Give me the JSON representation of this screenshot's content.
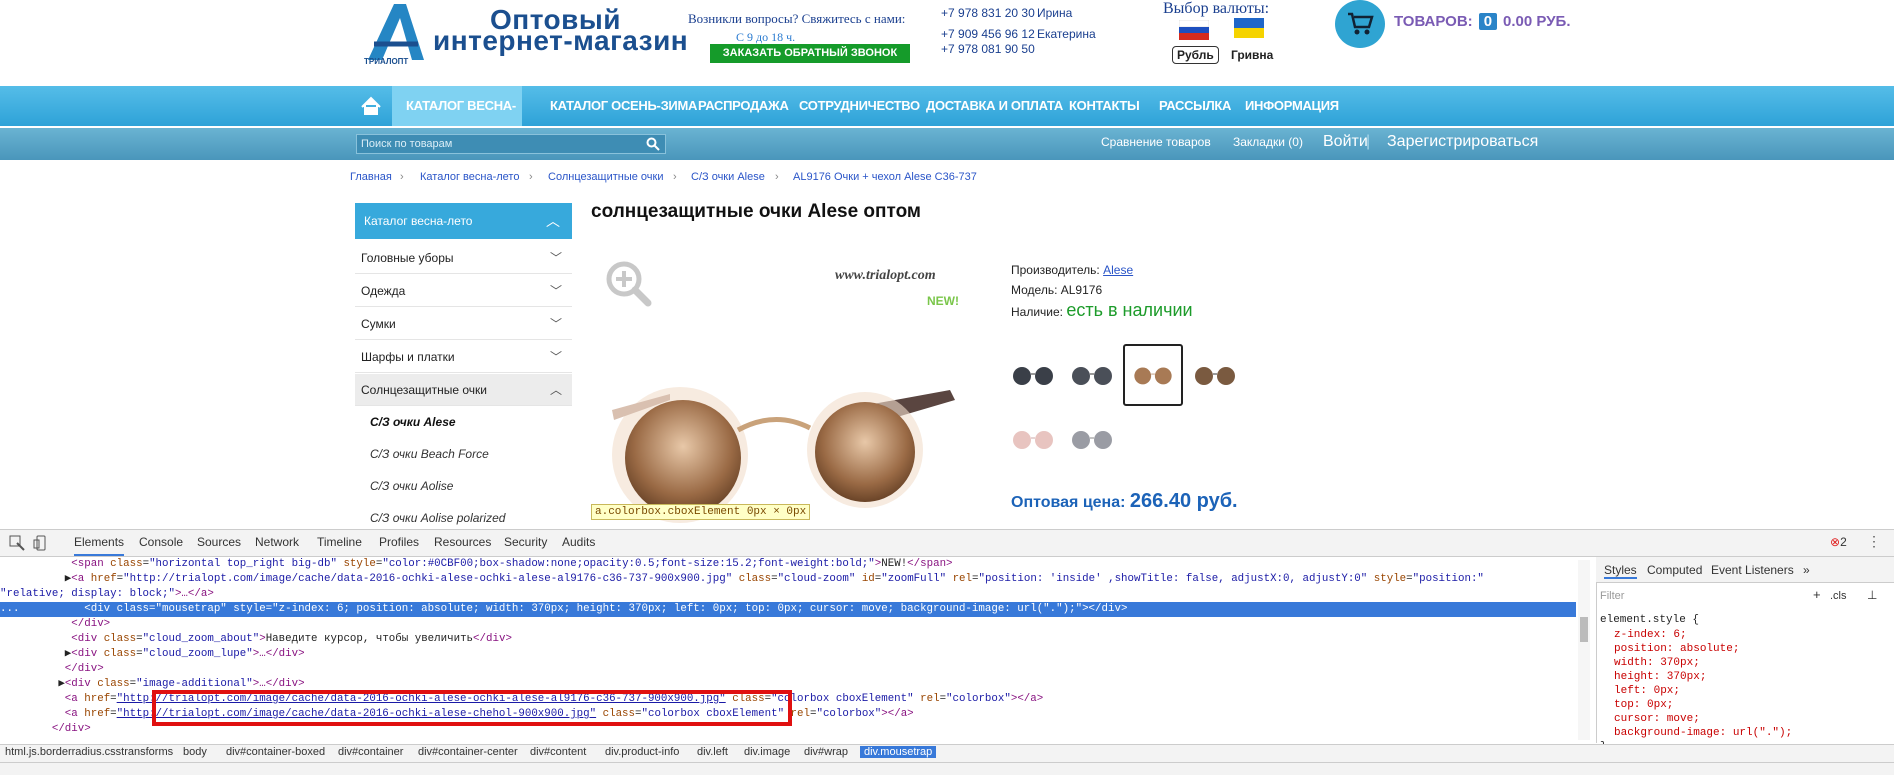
{
  "header": {
    "logo_line1": "Оптовый",
    "logo_line2": "интернет-магазин",
    "logo_small": "ТРИАЛОПТ",
    "questions": "Возникли вопросы? Свяжитесь с нами:",
    "hours": "С 9 до 18 ч.",
    "callback_label": "ЗАКАЗАТЬ ОБРАТНЫЙ ЗВОНОК",
    "phones": [
      {
        "number": "+7 978 831 20 30",
        "name": "Ирина"
      },
      {
        "number": "+7 909 456 96 12",
        "name": "Екатерина"
      },
      {
        "number": "+7 978 081 90 50",
        "name": ""
      }
    ],
    "currency_title": "Выбор валюты:",
    "currencies": [
      {
        "label": "Рубль",
        "flag": "russia-flag",
        "selected": true
      },
      {
        "label": "Гривна",
        "flag": "ukraine-flag",
        "selected": false
      }
    ],
    "cart_label": "ТОВАРОВ:",
    "cart_count": "0",
    "cart_total": "0.00 РУБ."
  },
  "nav": {
    "items": [
      {
        "label": "КАТАЛОГ ВЕСНА-ЛЕТО",
        "active": true
      },
      {
        "label": "КАТАЛОГ ОСЕНЬ-ЗИМА",
        "active": false
      },
      {
        "label": "РАСПРОДАЖА",
        "active": false
      },
      {
        "label": "СОТРУДНИЧЕСТВО",
        "active": false
      },
      {
        "label": "ДОСТАВКА И ОПЛАТА",
        "active": false
      },
      {
        "label": "КОНТАКТЫ",
        "active": false
      },
      {
        "label": "РАССЫЛКА",
        "active": false
      },
      {
        "label": "ИНФОРМАЦИЯ",
        "active": false
      }
    ]
  },
  "subbar": {
    "search_placeholder": "Поиск по товарам",
    "compare": "Сравнение товаров",
    "bookmarks": "Закладки (0)",
    "login": "Войти",
    "register": "Зарегистрироваться"
  },
  "breadcrumbs": [
    "Главная",
    "Каталог весна-лето",
    "Солнцезащитные очки",
    "С/З очки Alese",
    "AL9176 Очки + чехол Alese C36-737"
  ],
  "sidebar": {
    "header": "Каталог весна-лето",
    "items": [
      "Головные уборы",
      "Одежда",
      "Сумки",
      "Шарфы и платки",
      "Солнцезащитные очки"
    ],
    "subitems": [
      "С/З очки Alese",
      "С/З очки Beach Force",
      "С/З очки Aolise",
      "С/З очки Aolise polarized"
    ]
  },
  "product": {
    "title": "солнцезащитные очки Alese оптом",
    "watermark": "www.trialopt.com",
    "new_badge": "NEW!",
    "tooltip": "a.colorbox.cboxElement 0px × 0px",
    "manufacturer_label": "Производитель:",
    "manufacturer": "Alese",
    "model_label": "Модель:",
    "model": "AL9176",
    "stock_label": "Наличие:",
    "stock": "есть в наличии",
    "price_label": "Оптовая цена:",
    "price": "266.40 руб."
  },
  "devtools": {
    "tabs": [
      "Elements",
      "Console",
      "Sources",
      "Network",
      "Timeline",
      "Profiles",
      "Resources",
      "Security",
      "Audits"
    ],
    "error_count": "2",
    "side_tabs": [
      "Styles",
      "Computed",
      "Event Listeners"
    ],
    "filter_placeholder": "Filter",
    "cls_label": ".cls",
    "code": {
      "l1_class": "horizontal top_right big-db",
      "l1_style": "color:#0CBF00;box-shadow:none;opacity:0.5;font-size:15.2;font-weight:bold;",
      "l1_text": "NEW!",
      "l2_href": "http://trialopt.com/image/cache/data-2016-ochki-alese-ochki-alese-al9176-c36-737-900x900.jpg",
      "l2_class": "cloud-zoom",
      "l2_id": "zoomFull",
      "l2_rel": "position: 'inside' ,showTitle: false, adjustX:0, adjustY:0",
      "l2_style": "position:",
      "l2b": "relative; display: block;",
      "l3_class": "mousetrap",
      "l3_style": "z-index: 6; position: absolute; width: 370px; height: 370px; left: 0px; top: 0px; cursor: move; background-image: url(\".\");",
      "l4": "</div>",
      "l5_class": "cloud_zoom_about",
      "l5_text": "Наведите курсор, чтобы увеличить",
      "l6_class": "cloud_zoom_lupe",
      "l7": "</div>",
      "l8_class": "image-additional",
      "l9_href": "http://trialopt.com/image/cache/data-2016-ochki-alese-ochki-alese-al9176-c36-737-900x900.jpg",
      "l9_class": "colorbox cboxElement",
      "l9_rel": "colorbox",
      "l10_href": "http://trialopt.com/image/cache/data-2016-ochki-alese-chehol-900x900.jpg",
      "l10_class": "colorbox cboxElement",
      "l10_rel": "colorbox",
      "l11": "</div>"
    },
    "styles": {
      "selector": "element.style {",
      "props": [
        "z-index: 6;",
        "position: absolute;",
        "width: 370px;",
        "height: 370px;",
        "left: 0px;",
        "top: 0px;",
        "cursor: move;",
        "background-image: url(\".\");"
      ],
      "close": "}"
    },
    "crumbs": [
      "html.js.borderradius.csstransforms",
      "body",
      "div#container-boxed",
      "div#container",
      "div#container-center",
      "div#content",
      "div.product-info",
      "div.left",
      "div.image",
      "div#wrap",
      "div.mousetrap"
    ]
  }
}
